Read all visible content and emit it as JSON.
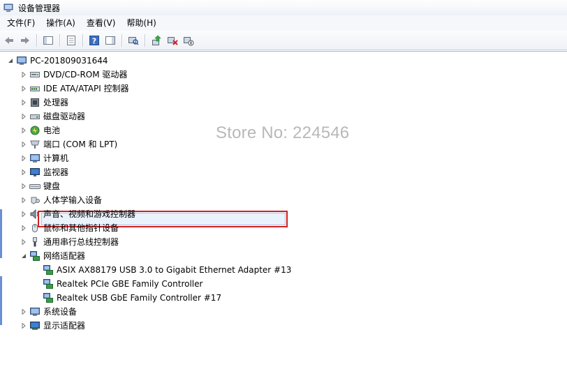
{
  "window": {
    "title": "设备管理器"
  },
  "menu": [
    "文件(F)",
    "操作(A)",
    "查看(V)",
    "帮助(H)"
  ],
  "toolbar": {
    "buttons": [
      {
        "icon": "back-arrow-icon"
      },
      {
        "icon": "forward-arrow-icon"
      },
      {
        "icon": "show-hide-console-tree-icon"
      },
      {
        "icon": "properties-icon"
      },
      {
        "icon": "help-icon"
      },
      {
        "icon": "show-action-pane-icon"
      },
      {
        "icon": "scan-hardware-icon"
      },
      {
        "icon": "update-driver-icon"
      },
      {
        "icon": "uninstall-icon"
      },
      {
        "icon": "disable-device-icon"
      }
    ]
  },
  "tree": {
    "root": "PC-201809031644",
    "categories": [
      {
        "label": "DVD/CD-ROM 驱动器",
        "icon": "dvd-drive-icon"
      },
      {
        "label": "IDE ATA/ATAPI 控制器",
        "icon": "ide-controller-icon"
      },
      {
        "label": "处理器",
        "icon": "processor-icon"
      },
      {
        "label": "磁盘驱动器",
        "icon": "disk-drive-icon"
      },
      {
        "label": "电池",
        "icon": "battery-icon"
      },
      {
        "label": "端口 (COM 和 LPT)",
        "icon": "port-icon"
      },
      {
        "label": "计算机",
        "icon": "computer-icon"
      },
      {
        "label": "监视器",
        "icon": "monitor-icon"
      },
      {
        "label": "键盘",
        "icon": "keyboard-icon"
      },
      {
        "label": "人体学输入设备",
        "icon": "hid-icon"
      },
      {
        "label": "声音、视频和游戏控制器",
        "icon": "sound-icon"
      },
      {
        "label": "鼠标和其他指针设备",
        "icon": "mouse-icon"
      },
      {
        "label": "通用串行总线控制器",
        "icon": "usb-icon"
      },
      {
        "label": "网络适配器",
        "icon": "network-adapter-icon",
        "expanded": true
      }
    ],
    "network_adapters": [
      "ASIX AX88179 USB 3.0 to Gigabit Ethernet Adapter #13",
      "Realtek PCIe GBE Family Controller",
      "Realtek USB GbE Family Controller #17"
    ],
    "after": [
      {
        "label": "系统设备",
        "icon": "system-devices-icon"
      },
      {
        "label": "显示适配器",
        "icon": "display-adapter-icon"
      }
    ]
  },
  "watermark": "Store No: 224546",
  "colors": {
    "highlight_border": "#d22020",
    "accent": "#6b8fd6"
  }
}
